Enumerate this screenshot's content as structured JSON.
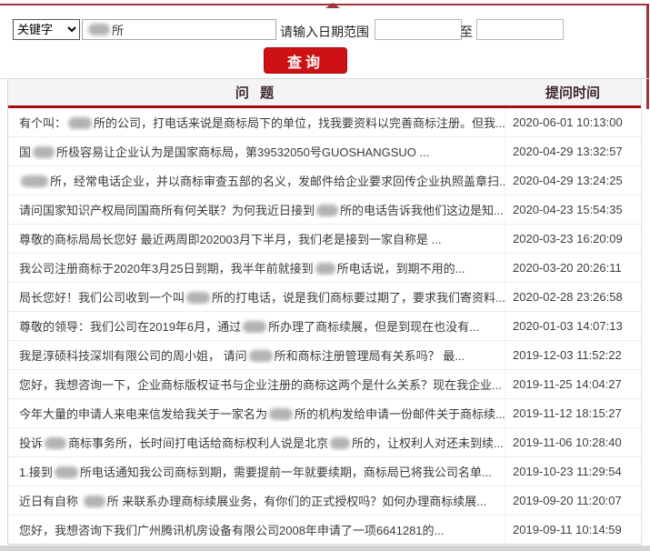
{
  "accent": {
    "line_red": "#a3333b",
    "header_rule_red": "#a50d12",
    "button_red": "#cd1115",
    "header_bg": "#f4f3f6"
  },
  "form": {
    "keyword_select_value": "关键字",
    "keyword_input_visible_text": "所",
    "date_range_label": "请输入日期范围",
    "date_from_value": "",
    "to_label": "至",
    "date_to_value": "",
    "search_button_label": "查询"
  },
  "table": {
    "headers": {
      "question": "问 题",
      "time": "提问时间"
    },
    "rows": [
      {
        "question": [
          {
            "text": "有个叫："
          },
          {
            "blur": 26
          },
          {
            "text": "所的公司，打电话来说是商标局下的单位，找我要资料以完善商标注册。但我..."
          }
        ],
        "time": "2020-06-01 10:13:00"
      },
      {
        "question": [
          {
            "text": "国"
          },
          {
            "blur": 24
          },
          {
            "text": "所极容易让企业认为是国家商标局，第39532050号GUOSHANGSUO ..."
          }
        ],
        "time": "2020-04-29 13:32:57"
      },
      {
        "question": [
          {
            "blur": 30
          },
          {
            "text": "所，经常电话企业，并以商标审查五部的名义，发邮件给企业要求回传企业执照盖章扫..."
          }
        ],
        "time": "2020-04-29 13:24:25"
      },
      {
        "question": [
          {
            "text": "请问国家知识产权局同国商所有何关联？为何我近日接到"
          },
          {
            "blur": 24
          },
          {
            "text": "所的电话告诉我他们这边是知..."
          }
        ],
        "time": "2020-04-23 15:54:35"
      },
      {
        "question": [
          {
            "text": "尊敬的商标局局长您好 最近两周即202003月下半月，我们老是接到一家自称是 ..."
          }
        ],
        "time": "2020-03-23 16:20:09"
      },
      {
        "question": [
          {
            "text": "我公司注册商标于2020年3月25日到期，我半年前就接到"
          },
          {
            "blur": 22
          },
          {
            "text": "所电话说，到期不用的..."
          }
        ],
        "time": "2020-03-20 20:26:11"
      },
      {
        "question": [
          {
            "text": "局长您好！我们公司收到一个叫"
          },
          {
            "blur": 26
          },
          {
            "text": "所的打电话，说是我们商标要过期了，要求我们寄资料..."
          }
        ],
        "time": "2020-02-28 23:26:58"
      },
      {
        "question": [
          {
            "text": "尊敬的领导：我们公司在2019年6月，通过"
          },
          {
            "blur": 26
          },
          {
            "text": "所办理了商标续展，但是到现在也没有..."
          }
        ],
        "time": "2020-01-03 14:07:13"
      },
      {
        "question": [
          {
            "text": "我是淳硕科技深圳有限公司的周小姐， 请问"
          },
          {
            "blur": 26
          },
          {
            "text": "所和商标注册管理局有关系吗？ 最..."
          }
        ],
        "time": "2019-12-03 11:52:22"
      },
      {
        "question": [
          {
            "text": "您好，我想咨询一下，企业商标版权证书与企业注册的商标这两个是什么关系？现在我企业..."
          }
        ],
        "time": "2019-11-25 14:04:27"
      },
      {
        "question": [
          {
            "text": "今年大量的申请人来电来信发给我关于一家名为"
          },
          {
            "blur": 26
          },
          {
            "text": "所的机构发给申请一份邮件关于商标续..."
          }
        ],
        "time": "2019-11-12 18:15:27"
      },
      {
        "question": [
          {
            "text": "投诉"
          },
          {
            "blur": 24
          },
          {
            "text": "商标事务所，长时间打电话给商标权利人说是北京"
          },
          {
            "blur": 22
          },
          {
            "text": "所的，让权利人对还未到续..."
          }
        ],
        "time": "2019-11-06 10:28:40"
      },
      {
        "question": [
          {
            "text": "1.接到"
          },
          {
            "blur": 26
          },
          {
            "text": "所电话通知我公司商标到期，需要提前一年就要续期，商标局已将我公司名单..."
          }
        ],
        "time": "2019-10-23 11:29:54"
      },
      {
        "question": [
          {
            "text": "近日有自称 "
          },
          {
            "blur": 24
          },
          {
            "text": "所 来联系办理商标续展业务，有你们的正式授权吗？如何办理商标续展..."
          }
        ],
        "time": "2019-09-20 11:20:07"
      },
      {
        "question": [
          {
            "text": "您好，我想咨询下我们广州腾讯机房设备有限公司2008年申请了一项6641281的..."
          }
        ],
        "time": "2019-09-11 10:14:59"
      }
    ]
  }
}
